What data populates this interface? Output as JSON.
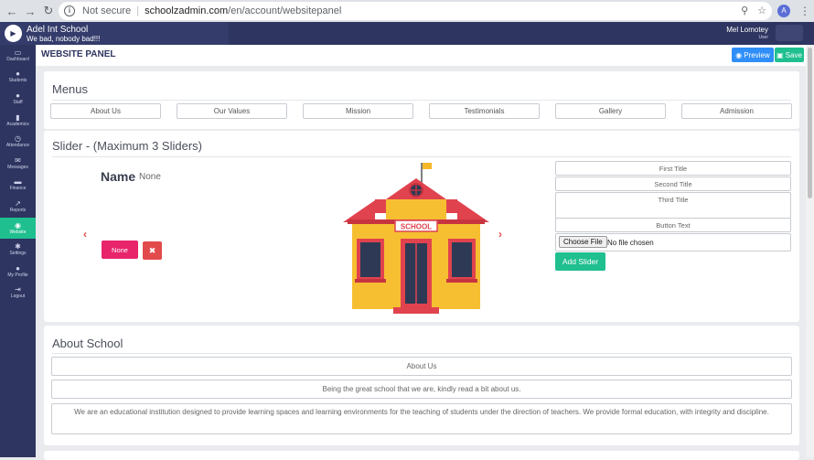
{
  "browser": {
    "security_label": "Not secure",
    "url_host": "schoolzadmin.com",
    "url_path": "/en/account/websitepanel",
    "profile_initial": "A"
  },
  "header": {
    "school_name": "Adel Int School",
    "tagline": "We bad, nobody bad!!!",
    "user_name": "Mel Lomotey",
    "user_role": "User"
  },
  "sidebar": {
    "items": [
      {
        "label": "Dashboard",
        "icon": "monitor-icon",
        "glyph": "▭"
      },
      {
        "label": "Students",
        "icon": "users-icon",
        "glyph": "●"
      },
      {
        "label": "Staff",
        "icon": "staff-icon",
        "glyph": "●"
      },
      {
        "label": "Academics",
        "icon": "book-icon",
        "glyph": "▮"
      },
      {
        "label": "Attendance",
        "icon": "clock-icon",
        "glyph": "◷"
      },
      {
        "label": "Messages",
        "icon": "envelope-icon",
        "glyph": "✉"
      },
      {
        "label": "Finance",
        "icon": "money-icon",
        "glyph": "▬"
      },
      {
        "label": "Reports",
        "icon": "chart-icon",
        "glyph": "↗"
      },
      {
        "label": "Website",
        "icon": "globe-icon",
        "glyph": "◉"
      },
      {
        "label": "Settings",
        "icon": "gear-icon",
        "glyph": "✱"
      },
      {
        "label": "My Profile",
        "icon": "user-icon",
        "glyph": "●"
      },
      {
        "label": "Logout",
        "icon": "logout-icon",
        "glyph": "⇥"
      }
    ]
  },
  "page": {
    "title": "WEBSITE PANEL",
    "preview_label": "Preview",
    "save_label": "Save"
  },
  "menus": {
    "title": "Menus",
    "items": [
      "About Us",
      "Our Values",
      "Mission",
      "Testimonials",
      "Gallery",
      "Admission"
    ]
  },
  "slider": {
    "title": "Slider - (Maximum 3 Sliders)",
    "name_label": "Name",
    "name_value": "None",
    "none_button": "None",
    "delete_glyph": "✖",
    "first_title_placeholder": "First Title",
    "second_title_placeholder": "Second Title",
    "third_title_placeholder": "Third Title",
    "button_text_placeholder": "Button Text",
    "choose_file_label": "Choose File",
    "no_file_label": "No file chosen",
    "add_label": "Add Slider",
    "school_sign": "SCHOOL"
  },
  "about": {
    "title": "About School",
    "heading_value": "About Us",
    "subheading_value": "Being the great school that we are, kindly read a bit about us.",
    "body_value": "We are an educational institution designed to provide learning spaces and learning environments for the teaching of students under the direction of teachers. We provide formal education, with integrity and discipline."
  },
  "colors": {
    "sidebar_bg": "#2e3560",
    "accent_green": "#1fbf8f",
    "preview_blue": "#2f8ef7",
    "none_pink": "#e8246a",
    "delete_red": "#e24b4b"
  }
}
